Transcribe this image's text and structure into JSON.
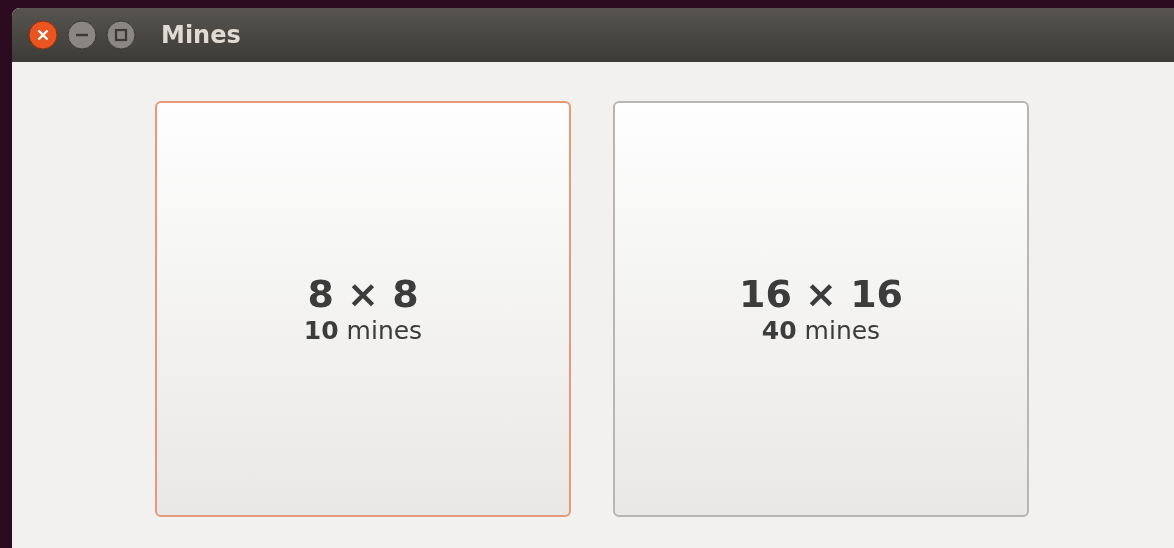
{
  "window": {
    "title": "Mines"
  },
  "cards": [
    {
      "size": "8 × 8",
      "mines": "**10** mines",
      "selected": true
    },
    {
      "size": "16 × 16",
      "mines": "**40** mines",
      "selected": false
    }
  ]
}
